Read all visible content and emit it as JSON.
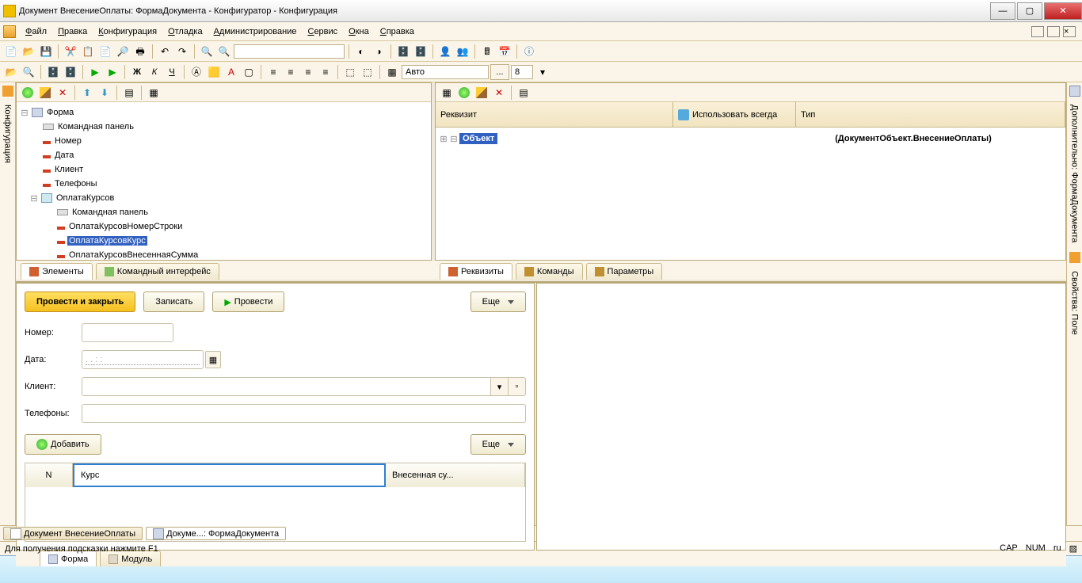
{
  "window": {
    "title": "Документ ВнесениеОплаты: ФормаДокумента - Конфигуратор - Конфигурация"
  },
  "menu": {
    "file": "Файл",
    "edit": "Правка",
    "config": "Конфигурация",
    "debug": "Отладка",
    "admin": "Администрирование",
    "service": "Сервис",
    "windows": "Окна",
    "help": "Справка"
  },
  "toolbar2": {
    "font_size_label": "Авто",
    "num_box": "8"
  },
  "left_rail": {
    "config": "Конфигурация"
  },
  "right_rail": {
    "extra": "Дополнительно: ФормаДокумента",
    "props": "Свойства: Поле"
  },
  "tree": {
    "root": "Форма",
    "cmd_panel": "Командная панель",
    "number": "Номер",
    "date": "Дата",
    "client": "Клиент",
    "phones": "Телефоны",
    "pay_courses": "ОплатаКурсов",
    "pc_cmd": "Командная панель",
    "pc_row": "ОплатаКурсовНомерСтроки",
    "pc_course": "ОплатаКурсовКурс",
    "pc_sum": "ОплатаКурсовВнесеннаяСумма"
  },
  "right_pane": {
    "toolbar_placeholder": "",
    "col_req": "Реквизит",
    "col_use": "Использовать всегда",
    "col_type": "Тип",
    "obj": "Объект",
    "obj_type": "(ДокументОбъект.ВнесениеОплаты)"
  },
  "tabs_left": {
    "elements": "Элементы",
    "cmd_iface": "Командный интерфейс"
  },
  "tabs_right": {
    "req": "Реквизиты",
    "cmd": "Команды",
    "param": "Параметры"
  },
  "form_preview": {
    "post_close": "Провести и закрыть",
    "write": "Записать",
    "post": "Провести",
    "more": "Еще",
    "num_label": "Номер:",
    "date_label": "Дата:",
    "date_placeholder": ".  .        :  :",
    "client_label": "Клиент:",
    "phones_label": "Телефоны:",
    "add": "Добавить",
    "more2": "Еще",
    "col_n": "N",
    "col_course": "Курс",
    "col_sum": "Внесенная су..."
  },
  "bottom_tabs": {
    "form": "Форма",
    "module": "Модуль"
  },
  "window_tabs": {
    "t1": "Документ ВнесениеОплаты",
    "t2": "Докуме...: ФормаДокумента"
  },
  "status": {
    "hint": "Для получения подсказки нажмите F1",
    "cap": "CAP",
    "num": "NUM",
    "lang": "ru"
  }
}
